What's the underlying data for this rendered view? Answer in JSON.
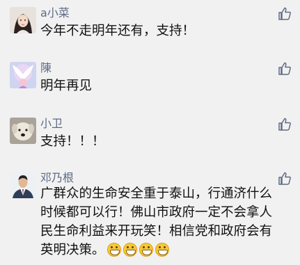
{
  "comments": [
    {
      "name": "a小菜",
      "text": "今年不走明年还有，支持！"
    },
    {
      "name": "陳",
      "text": "明年再见"
    },
    {
      "name": "小卫",
      "text": "支持！！！"
    },
    {
      "name": "邓乃根",
      "text": "广群众的生命安全重于泰山，行通济什么时候都可以行！佛山市政府一定不会拿人民生命利益来开玩笑！相信党和政府会有英明决策。",
      "emoji_count": 4,
      "emoji_icon": "grinning-face-icon"
    }
  ],
  "icons": {
    "like": "thumbs-up-icon"
  },
  "colors": {
    "background": "#f1f1f1",
    "name": "#5d6a85",
    "text": "#111111",
    "like": "#5d6a85"
  }
}
